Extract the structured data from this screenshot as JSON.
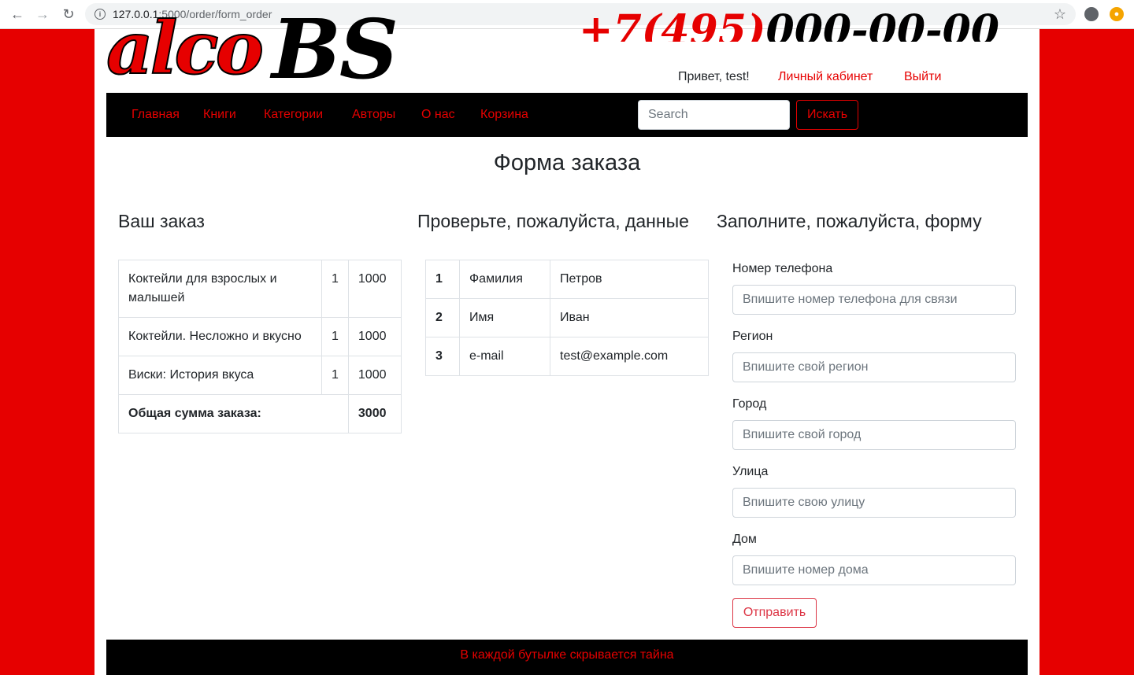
{
  "browser": {
    "url_host": "127.0.0.1",
    "url_path": ":5000/order/form_order"
  },
  "header": {
    "logo_part1": "alco",
    "logo_part2": "BS",
    "phone_red": "+7(495)",
    "phone_black": "000-00-00",
    "greeting": "Привет, test!",
    "cabinet_link": "Личный кабинет",
    "logout_link": "Выйти"
  },
  "nav": {
    "items": [
      "Главная",
      "Книги",
      "Категории",
      "Авторы",
      "О нас",
      "Корзина"
    ],
    "search_placeholder": "Search",
    "search_button": "Искать"
  },
  "page": {
    "title": "Форма заказа"
  },
  "order": {
    "title": "Ваш заказ",
    "rows": [
      {
        "name": "Коктейли для взрослых и малышей",
        "qty": "1",
        "price": "1000"
      },
      {
        "name": "Коктейли. Несложно и вкусно",
        "qty": "1",
        "price": "1000"
      },
      {
        "name": "Виски: История вкуса",
        "qty": "1",
        "price": "1000"
      }
    ],
    "total_label": "Общая сумма заказа:",
    "total_value": "3000"
  },
  "check": {
    "title": "Проверьте, пожалуйста, данные",
    "rows": [
      {
        "num": "1",
        "field": "Фамилия",
        "value": "Петров"
      },
      {
        "num": "2",
        "field": "Имя",
        "value": "Иван"
      },
      {
        "num": "3",
        "field": "e-mail",
        "value": "test@example.com"
      }
    ]
  },
  "form": {
    "title": "Заполните, пожалуйста, форму",
    "fields": [
      {
        "label": "Номер телефона",
        "placeholder": "Впишите номер телефона для связи"
      },
      {
        "label": "Регион",
        "placeholder": "Впишите свой регион"
      },
      {
        "label": "Город",
        "placeholder": "Впишите свой город"
      },
      {
        "label": "Улица",
        "placeholder": "Впишите свою улицу"
      },
      {
        "label": "Дом",
        "placeholder": "Впишите номер дома"
      }
    ],
    "submit_label": "Отправить"
  },
  "footer": {
    "text": "В каждой бутылке скрывается тайна"
  }
}
